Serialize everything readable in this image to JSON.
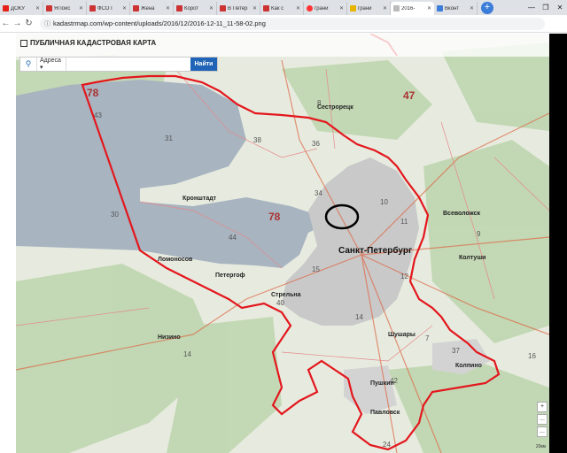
{
  "browser": {
    "tabs": [
      {
        "title": "ДОКУ",
        "icon": "youtube-icon",
        "color": "#e62117"
      },
      {
        "title": "ЯПоис",
        "icon": "page-icon",
        "color": "#c33"
      },
      {
        "title": "ФСО Г",
        "icon": "page-icon",
        "color": "#c33"
      },
      {
        "title": "Жена",
        "icon": "page-icon",
        "color": "#c33"
      },
      {
        "title": "Корот",
        "icon": "page-icon",
        "color": "#c33"
      },
      {
        "title": "В Петер",
        "icon": "page-icon",
        "color": "#c33"
      },
      {
        "title": "Как с",
        "icon": "page-icon",
        "color": "#c33"
      },
      {
        "title": "грани",
        "icon": "yandex-icon",
        "color": "#f33"
      },
      {
        "title": "грани",
        "icon": "page-icon",
        "color": "#e8b400"
      },
      {
        "title": "2016-",
        "icon": "page-icon",
        "color": "#bbb",
        "active": true
      },
      {
        "title": "Вконт",
        "icon": "page-icon",
        "color": "#3c7dd9"
      }
    ],
    "new_tab": "+",
    "url": "kadastrmap.com/wp-content/uploads/2016/12/2016-12-11_11-58-02.png"
  },
  "map": {
    "header_title": "ПУБЛИЧНАЯ КАДАСТРОВАЯ КАРТА",
    "search_selector": "Адреса",
    "search_placeholder": "",
    "find_button": "Найти",
    "city_label": "Санкт-Петербург",
    "region_codes": {
      "spb": "78",
      "lo": "47",
      "spb_east": "78"
    },
    "district_numbers": [
      "43",
      "38",
      "30",
      "44",
      "34",
      "36",
      "10",
      "11",
      "12",
      "15",
      "40",
      "14",
      "42",
      "37",
      "9",
      "16",
      "24",
      "14",
      "7",
      "8",
      "31"
    ],
    "towns": [
      "Кронштадт",
      "Всеволожск",
      "Сестрорецк",
      "Колпино",
      "Павловск",
      "Ломоносов",
      "Пушкин",
      "Стрельна",
      "Петергоф",
      "Шушары",
      "Колтуши",
      "Низино"
    ],
    "scale_text": "20км",
    "controls": [
      "+",
      "...",
      "..."
    ]
  },
  "colors": {
    "water": "#a7b3bf",
    "boundary": "#e3171d",
    "city": "#c7c7c7",
    "forest": "#b7d2a8",
    "accent": "#1f64b6"
  }
}
